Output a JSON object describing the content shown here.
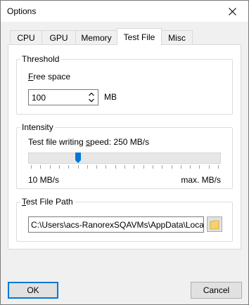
{
  "window": {
    "title": "Options"
  },
  "tabs": [
    {
      "label": "CPU",
      "active": false
    },
    {
      "label": "GPU",
      "active": false
    },
    {
      "label": "Memory",
      "active": false
    },
    {
      "label": "Test File",
      "active": true
    },
    {
      "label": "Misc",
      "active": false
    }
  ],
  "threshold": {
    "group_title": "Threshold",
    "label_prefix": "",
    "label_mnemonic": "F",
    "label_rest": "ree space",
    "value": "100",
    "unit": "MB"
  },
  "intensity": {
    "group_title": "Intensity",
    "label_prefix": "Test file writing ",
    "label_mnemonic": "s",
    "label_rest": "peed: 250 MB/s",
    "min_label": "10 MB/s",
    "max_label": "max. MB/s",
    "slider_position": 0.25,
    "tick_count": 20
  },
  "test_file_path": {
    "group_title_prefix": "",
    "group_title_mnemonic": "T",
    "group_title_rest": "est File Path",
    "value": "C:\\Users\\acs-RanorexSQAVMs\\AppData\\Local"
  },
  "buttons": {
    "ok": "OK",
    "cancel": "Cancel"
  },
  "colors": {
    "accent": "#0078d7",
    "folder": "#f5d26b"
  }
}
